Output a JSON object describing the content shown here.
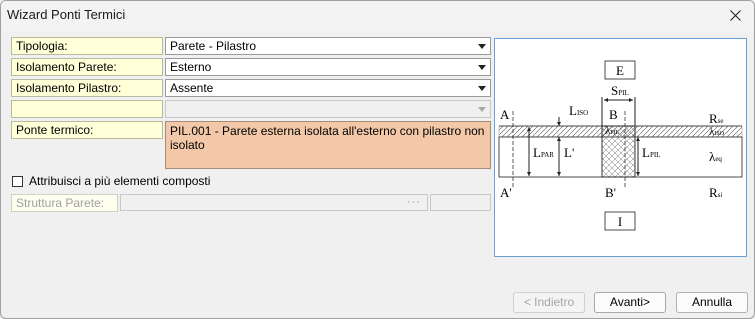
{
  "window": {
    "title": "Wizard Ponti Termici"
  },
  "form": {
    "tipologia": {
      "label": "Tipologia:",
      "value": "Parete - Pilastro"
    },
    "isolamento_parete": {
      "label": "Isolamento Parete:",
      "value": "Esterno"
    },
    "isolamento_pilastro": {
      "label": "Isolamento Pilastro:",
      "value": "Assente"
    },
    "empty_row": {
      "label": "",
      "value": ""
    },
    "ponte_termico": {
      "label": "Ponte termico:",
      "value": "PIL.001 - Parete esterna isolata all'esterno con pilastro non isolato"
    },
    "attribuisci": {
      "label": "Attribuisci a più elementi composti",
      "checked": false
    },
    "struttura_parete": {
      "label": "Struttura Parete:",
      "value": "",
      "browse": "···"
    }
  },
  "diagram": {
    "E": "E",
    "I": "I",
    "S": "S",
    "S_sub": "PIL",
    "B": "B",
    "B2": "B'",
    "A": "A",
    "A2": "A'",
    "L": "L",
    "L_iso_sub": "ISO",
    "L_par_sub": "PAR",
    "L_prime": "L'",
    "L_pil_sub": "PIL",
    "lambda_pil": "λ",
    "lambda_pil_sub": "PIL",
    "R": "R",
    "R_se_sub": "se",
    "R_si_sub": "si",
    "lambda_iso": "λ",
    "lambda_iso_sub": "ISO",
    "lambda_eq": "λ",
    "lambda_eq_sub": "eq"
  },
  "buttons": {
    "back": "< Indietro",
    "next": "Avanti>",
    "cancel": "Annulla"
  }
}
